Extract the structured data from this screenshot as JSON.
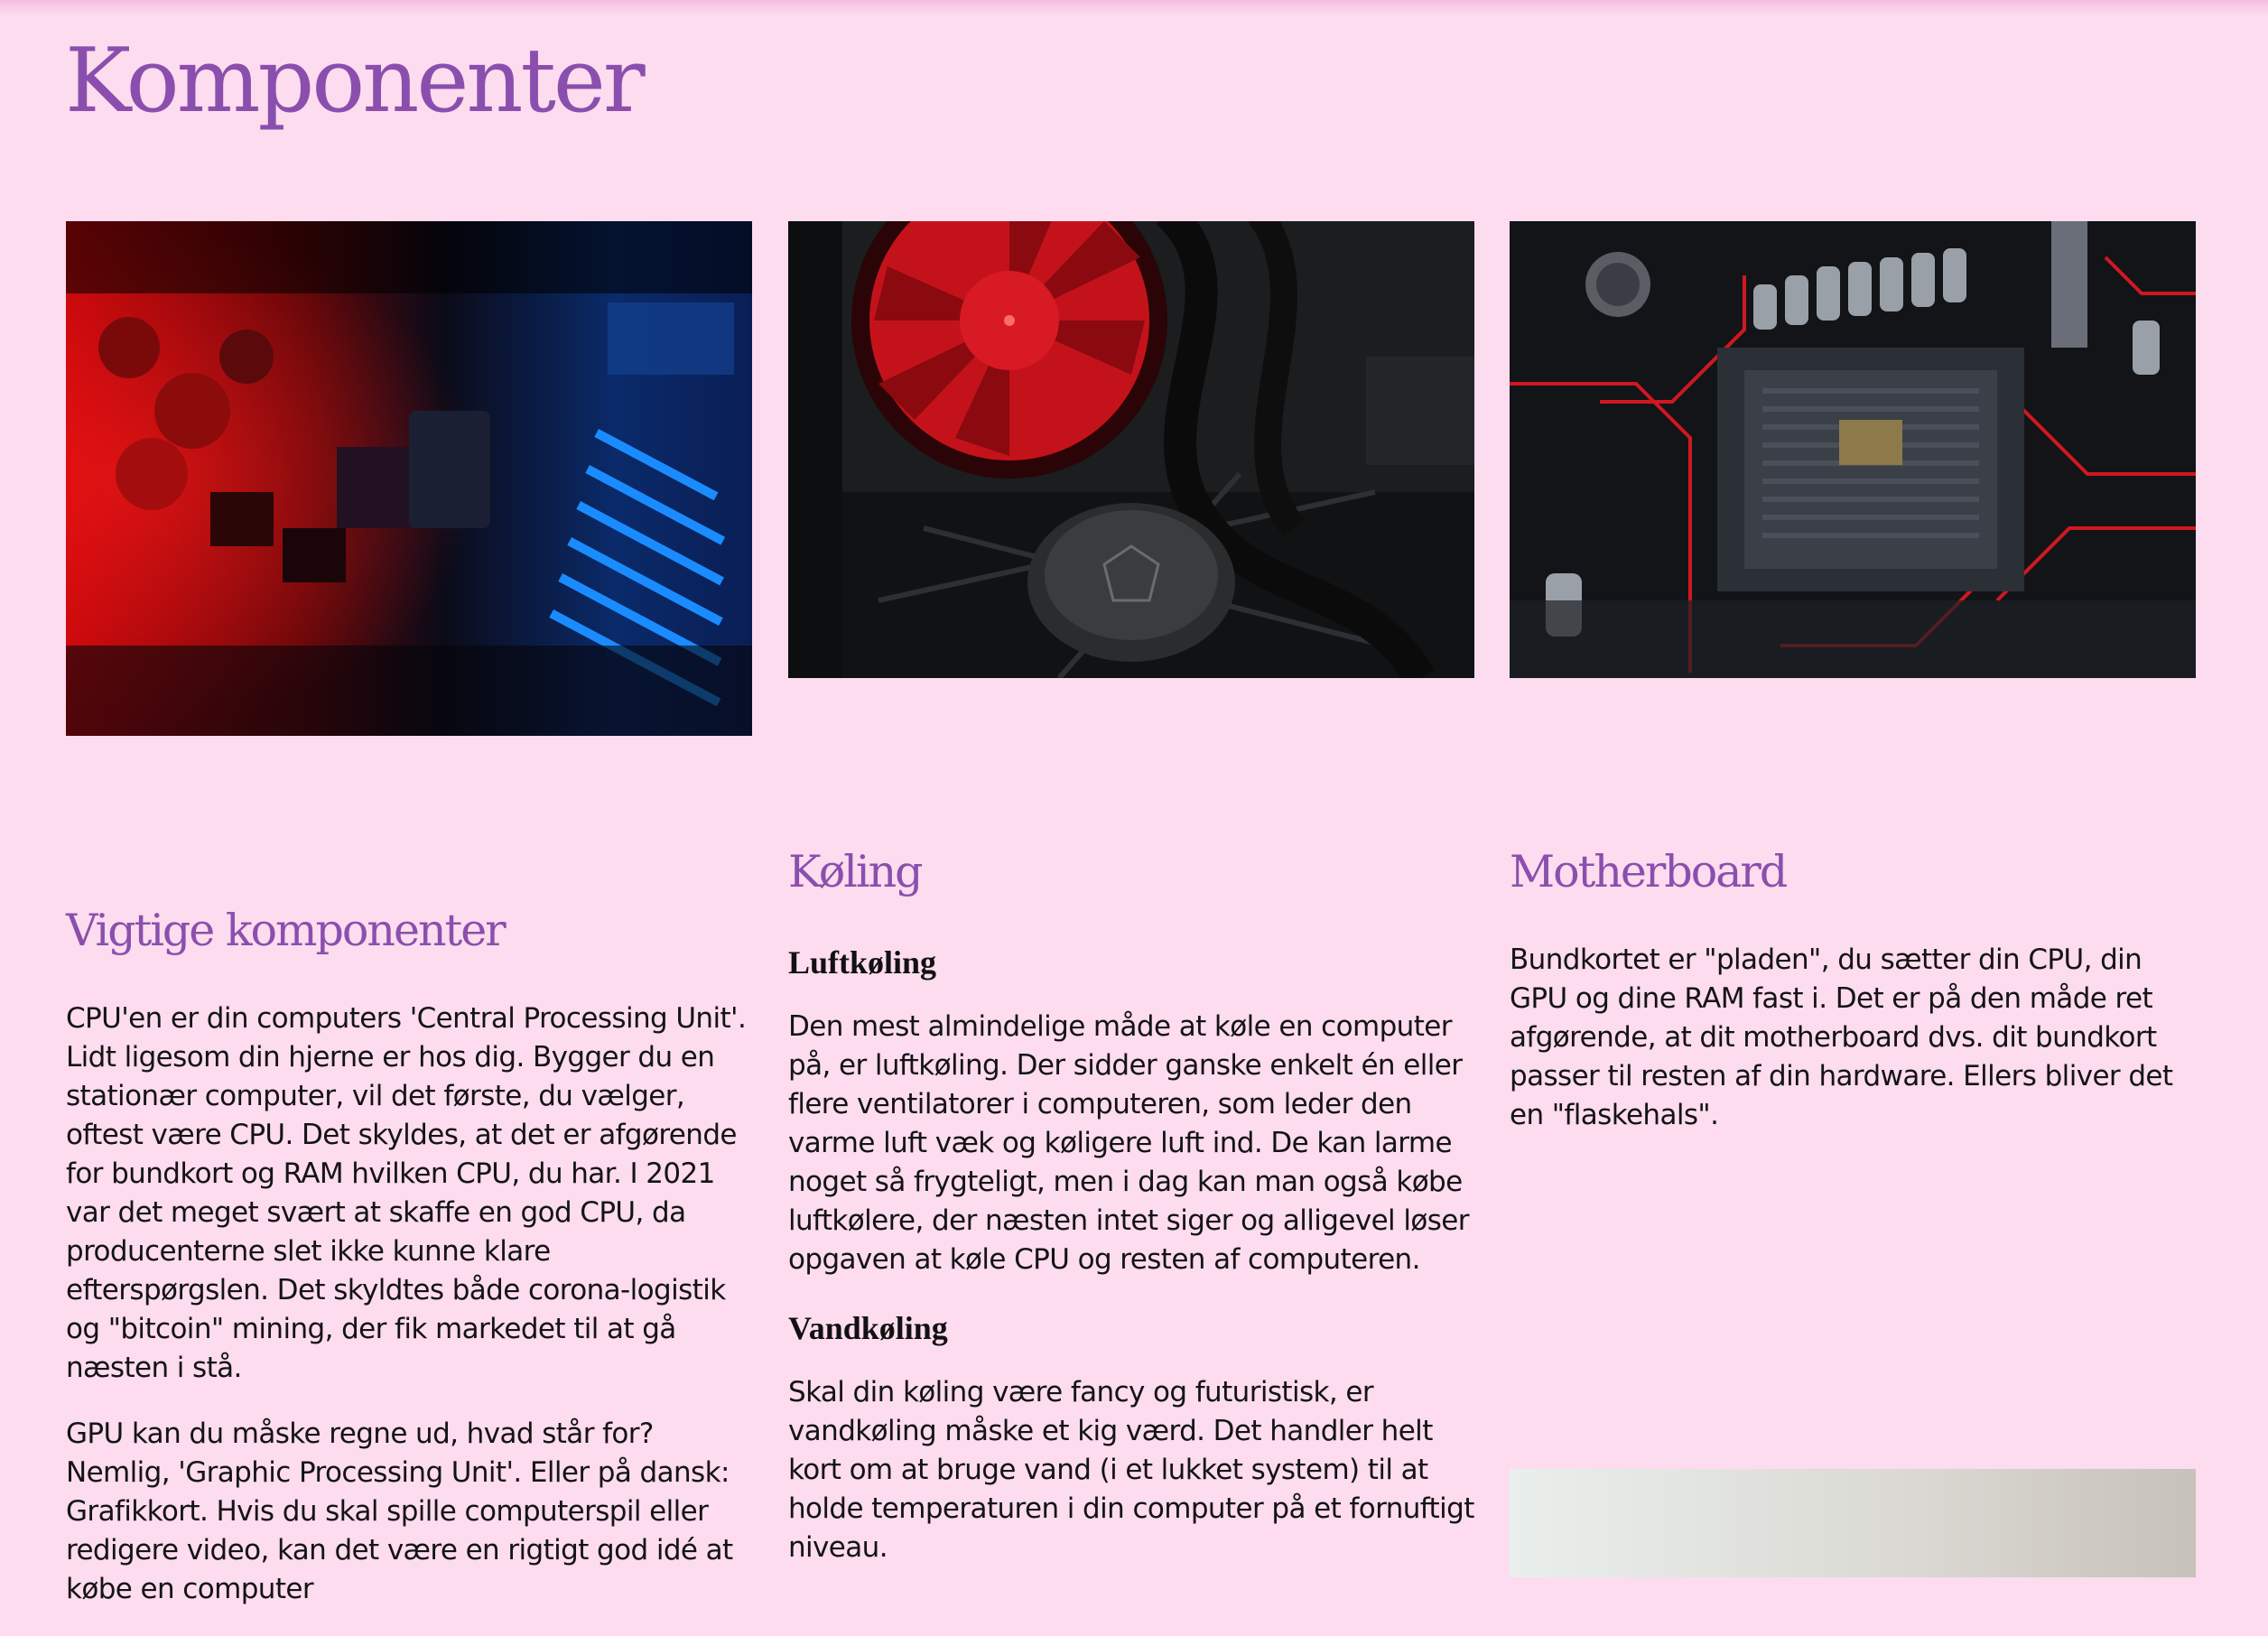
{
  "page": {
    "title": "Komponenter"
  },
  "images": [
    {
      "icon": "pcb-components-red-blue-photo"
    },
    {
      "icon": "cpu-cooler-red-fan-photo"
    },
    {
      "icon": "motherboard-cpu-socket-photo"
    },
    {
      "icon": "white-hardware-photo"
    }
  ],
  "columns": [
    {
      "heading": "Vigtige komponenter",
      "paragraphs": [
        "CPU'en er din computers 'Central Processing Unit'. Lidt ligesom din hjerne er hos dig. Bygger du en stationær computer, vil det første, du vælger, oftest være CPU. Det skyldes, at det er afgørende for bundkort og RAM hvilken CPU, du har. I 2021 var det meget svært at skaffe en god CPU, da producenterne slet ikke kunne klare efterspørgslen. Det skyldtes både corona-logistik og \"bitcoin\" mining, der fik markedet til at gå næsten i stå.",
        "GPU kan du måske regne ud, hvad står for? Nemlig, 'Graphic Processing Unit'. Eller på dansk: Grafikkort. Hvis du skal spille computerspil eller redigere video, kan det være en rigtigt god idé at købe en computer"
      ]
    },
    {
      "heading": "Køling",
      "sections": [
        {
          "subheading": "Luftkøling",
          "text": "Den mest almindelige måde at køle en computer på, er luftkøling. Der sidder ganske enkelt én eller flere ventilatorer i computeren, som leder den varme luft væk og køligere luft ind. De kan larme noget så frygteligt, men i dag kan man også købe luftkølere, der næsten intet siger og alligevel løser opgaven at køle CPU og resten af computeren."
        },
        {
          "subheading": "Vandkøling",
          "text": "Skal din køling være fancy og futuristisk, er vandkøling måske et kig værd. Det handler helt kort om at bruge vand (i et lukket system) til at holde temperaturen i din computer på et fornuftigt niveau."
        }
      ]
    },
    {
      "heading": "Motherboard",
      "paragraphs": [
        "Bundkortet er \"pladen\", du sætter din CPU, din GPU og dine RAM fast i. Det er på den måde ret afgørende, at dit motherboard dvs. dit bundkort passer til resten af din hardware. Ellers bliver det en \"flaskehals\"."
      ]
    }
  ]
}
